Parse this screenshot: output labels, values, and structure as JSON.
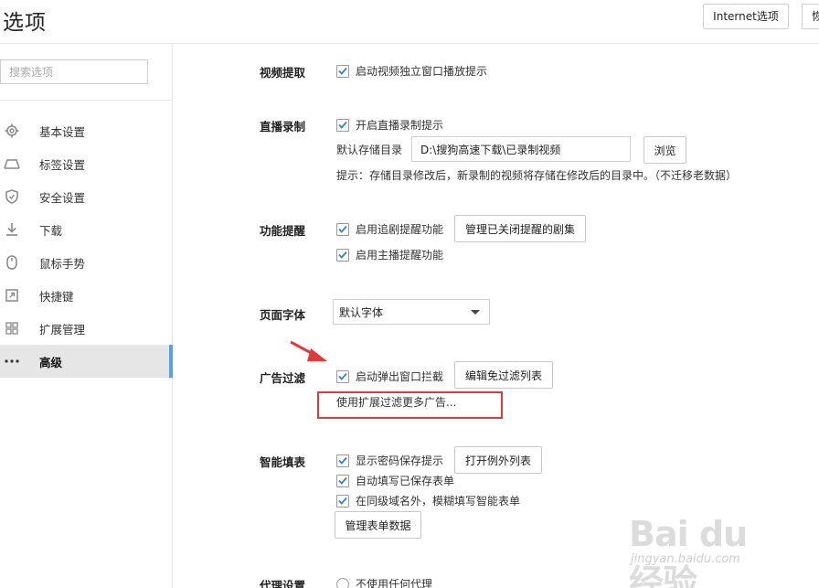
{
  "window": {
    "title": "选项"
  },
  "header": {
    "internet_options_label": "Internet选项",
    "restore_label": "恢"
  },
  "sidebar": {
    "search_placeholder": "搜索选项",
    "items": [
      {
        "label": "基本设置",
        "icon": "gear-icon"
      },
      {
        "label": "标签设置",
        "icon": "tab-icon"
      },
      {
        "label": "安全设置",
        "icon": "shield-icon"
      },
      {
        "label": "下载",
        "icon": "download-icon"
      },
      {
        "label": "鼠标手势",
        "icon": "mouse-icon"
      },
      {
        "label": "快捷键",
        "icon": "shortcut-icon"
      },
      {
        "label": "扩展管理",
        "icon": "extensions-icon"
      },
      {
        "label": "高级",
        "icon": "more-icon",
        "active": true
      }
    ]
  },
  "sections": {
    "video": {
      "label": "视频提取",
      "option1": "启动视频独立窗口播放提示"
    },
    "live": {
      "label": "直播录制",
      "option1": "开启直播录制提示",
      "dir_label": "默认存储目录",
      "dir_value": "D:\\搜狗高速下载\\已录制视频",
      "browse": "浏览",
      "hint": "提示：存储目录修改后，新录制的视频将存储在修改后的目录中。（不迁移老数据）"
    },
    "remind": {
      "label": "功能提醒",
      "option1": "启用追剧提醒功能",
      "manage_button": "管理已关闭提醒的剧集",
      "option2": "启用主播提醒功能"
    },
    "font": {
      "label": "页面字体",
      "selected": "默认字体"
    },
    "adfilter": {
      "label": "广告过滤",
      "option1": "启动弹出窗口拦截",
      "edit_button": "编辑免过滤列表",
      "extension_link": "使用扩展过滤更多广告..."
    },
    "autofill": {
      "label": "智能填表",
      "option1": "显示密码保存提示",
      "exceptions_button": "打开例外列表",
      "option2": "自动填写已保存表单",
      "option3": "在同级域名外，模糊填写智能表单",
      "manage_button": "管理表单数据"
    },
    "proxy": {
      "label": "代理设置",
      "option1": "不使用任何代理"
    }
  },
  "annotation": {
    "color": "#e03a3a"
  },
  "watermark": {
    "main": "Bai du 经验",
    "sub": "jingyan.baidu.com"
  },
  "colors": {
    "accent": "#5aa0e8",
    "checkbox": "#3a7fd0"
  }
}
